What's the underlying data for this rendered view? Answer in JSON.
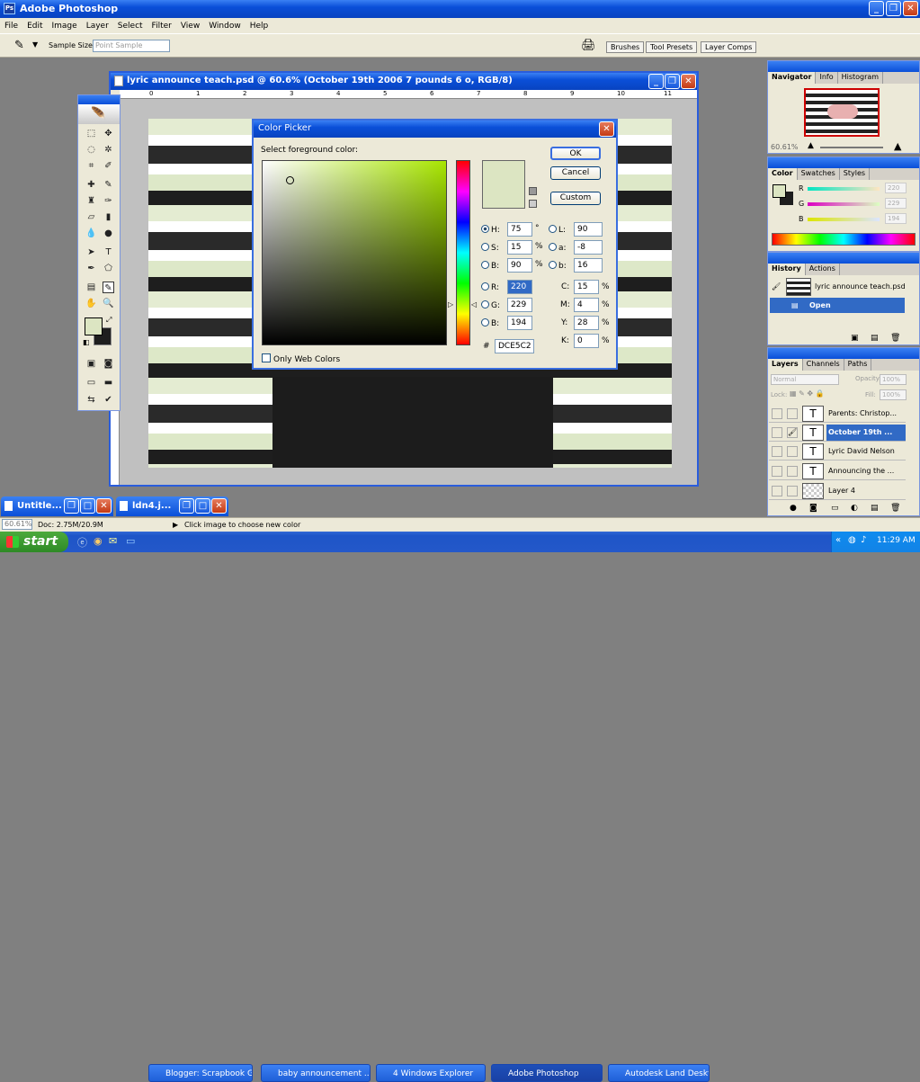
{
  "app": {
    "title": "Adobe Photoshop"
  },
  "menu": [
    "File",
    "Edit",
    "Image",
    "Layer",
    "Select",
    "Filter",
    "View",
    "Window",
    "Help"
  ],
  "options": {
    "sample_size_label": "Sample Size:",
    "sample_size_value": "Point Sample"
  },
  "well_tabs": [
    "Brushes",
    "Tool Presets",
    "Layer Comps"
  ],
  "doc": {
    "title": "lyric announce teach.psd @ 60.6% (October 19th 2006 7 pounds 6 o, RGB/8)",
    "ruler": [
      "0",
      "1",
      "2",
      "3",
      "4",
      "5",
      "6",
      "7",
      "8",
      "9",
      "10",
      "11"
    ]
  },
  "picker": {
    "title": "Color Picker",
    "prompt": "Select foreground color:",
    "ok": "OK",
    "cancel": "Cancel",
    "custom": "Custom",
    "hsb": [
      {
        "label": "H:",
        "value": "75",
        "unit": "°"
      },
      {
        "label": "S:",
        "value": "15",
        "unit": "%"
      },
      {
        "label": "B:",
        "value": "90",
        "unit": "%"
      }
    ],
    "rgb": [
      {
        "label": "R:",
        "value": "220"
      },
      {
        "label": "G:",
        "value": "229"
      },
      {
        "label": "B:",
        "value": "194"
      }
    ],
    "lab": [
      {
        "label": "L:",
        "value": "90"
      },
      {
        "label": "a:",
        "value": "-8"
      },
      {
        "label": "b:",
        "value": "16"
      }
    ],
    "cmyk": [
      {
        "label": "C:",
        "value": "15",
        "unit": "%"
      },
      {
        "label": "M:",
        "value": "4",
        "unit": "%"
      },
      {
        "label": "Y:",
        "value": "28",
        "unit": "%"
      },
      {
        "label": "K:",
        "value": "0",
        "unit": "%"
      }
    ],
    "hex_label": "#",
    "hex": "DCE5C2",
    "web_only": "Only Web Colors",
    "current_color": "#dce5c2",
    "hue_color": "#a8e600"
  },
  "navigator": {
    "tabs": [
      "Navigator",
      "Info",
      "Histogram"
    ],
    "zoom": "60.61%"
  },
  "color_panel": {
    "tabs": [
      "Color",
      "Swatches",
      "Styles"
    ],
    "sliders": [
      {
        "label": "R",
        "value": "220"
      },
      {
        "label": "G",
        "value": "229"
      },
      {
        "label": "B",
        "value": "194"
      }
    ]
  },
  "history": {
    "tabs": [
      "History",
      "Actions"
    ],
    "snapshot": "lyric announce teach.psd",
    "items": [
      "Open"
    ]
  },
  "layers": {
    "tabs": [
      "Layers",
      "Channels",
      "Paths"
    ],
    "blend": "Normal",
    "opacity_label": "Opacity:",
    "opacity": "100%",
    "lock_label": "Lock:",
    "fill_label": "Fill:",
    "fill": "100%",
    "rows": [
      {
        "name": "Parents: Christop..."
      },
      {
        "name": "October 19th ..."
      },
      {
        "name": "Lyric David Nelson"
      },
      {
        "name": "Announcing the ..."
      },
      {
        "name": "Layer 4"
      }
    ]
  },
  "min_docs": [
    "Untitle...",
    "ldn4.j..."
  ],
  "status": {
    "zoom": "60.61%",
    "doc": "Doc: 2.75M/20.9M",
    "hint": "Click image to choose new color"
  },
  "taskbar": {
    "start": "start",
    "items": [
      "Blogger: Scrapbook G...",
      "baby announcement ...",
      "4 Windows Explorer",
      "Adobe Photoshop",
      "Autodesk Land Deskt..."
    ],
    "time": "11:29 AM"
  }
}
